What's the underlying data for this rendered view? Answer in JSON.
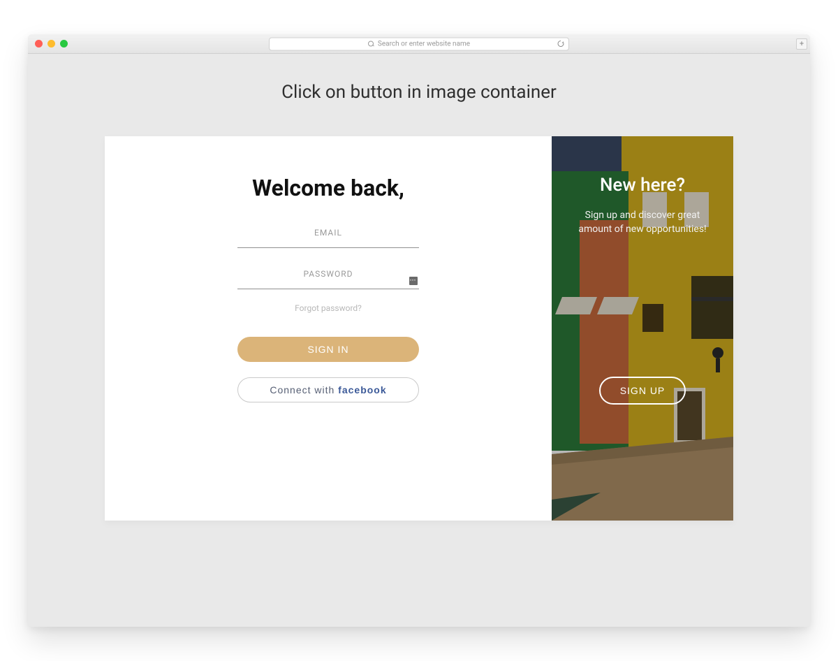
{
  "browser": {
    "address_placeholder": "Search or enter website name"
  },
  "page": {
    "heading": "Click on button in image container"
  },
  "login": {
    "title": "Welcome back,",
    "email_label": "EMAIL",
    "password_label": "PASSWORD",
    "forgot": "Forgot password?",
    "signin_label": "SIGN IN",
    "connect_prefix": "Connect with ",
    "connect_brand": "facebook"
  },
  "promo": {
    "title": "New here?",
    "subtitle": "Sign up and discover great amount of new opportunities!",
    "signup_label": "SIGN UP"
  }
}
